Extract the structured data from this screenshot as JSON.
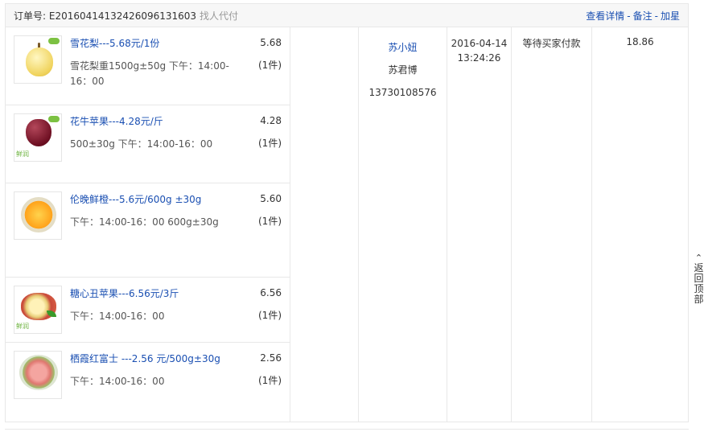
{
  "header": {
    "order_label": "订单号: E20160414132426096131603",
    "order_tag": "找人代付",
    "links": [
      "查看详情",
      "备注",
      "加星"
    ],
    "sep": "-"
  },
  "items": [
    {
      "name": "雪花梨---5.68元/1份",
      "desc": "雪花梨重1500g±50g 下午：14:00-16：00",
      "price": "5.68",
      "qty": "(1件)",
      "icon": "pear-icon"
    },
    {
      "name": "花牛苹果---4.28元/斤",
      "desc": "500±30g 下午：14:00-16：00",
      "price": "4.28",
      "qty": "(1件)",
      "icon": "red-apple-icon"
    },
    {
      "name": "伦晚鲜橙---5.6元/600g ±30g",
      "desc": "下午：14:00-16：00 600g±30g",
      "price": "5.60",
      "qty": "(1件)",
      "icon": "orange-icon"
    },
    {
      "name": "糖心丑苹果---6.56元/3斤",
      "desc": "下午：14:00-16：00",
      "price": "6.56",
      "qty": "(1件)",
      "icon": "cut-apple-icon"
    },
    {
      "name": "栖霞红富士 ---2.56 元/500g±30g",
      "desc": "下午：14:00-16：00",
      "price": "2.56",
      "qty": "(1件)",
      "icon": "fuji-apple-icon"
    }
  ],
  "buyer": {
    "nickname": "苏小妞",
    "name": "苏君博",
    "phone": "13730108576"
  },
  "time": {
    "date": "2016-04-14",
    "clock": "13:24:26"
  },
  "status": "等待买家付款",
  "total": "18.86",
  "back_to_top": [
    "返",
    "回",
    "顶",
    "部"
  ]
}
